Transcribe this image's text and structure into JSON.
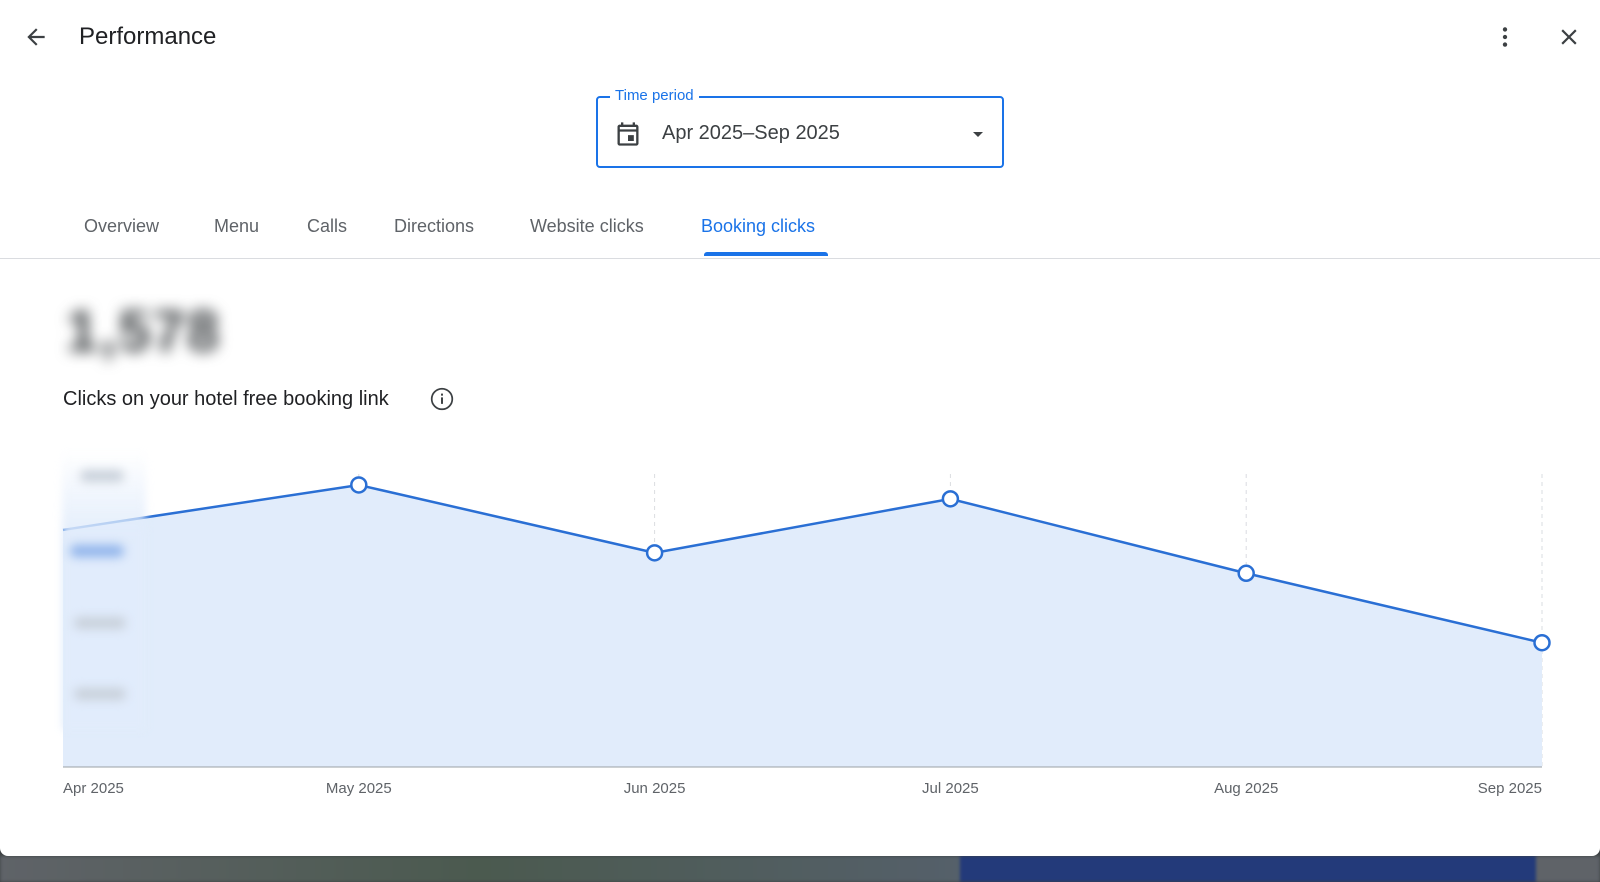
{
  "header": {
    "title": "Performance",
    "back_icon": "arrow-back-icon",
    "more_icon": "more-vert-icon",
    "close_icon": "close-icon"
  },
  "time_period": {
    "label": "Time period",
    "value": "Apr 2025–Sep 2025",
    "icon": "calendar-icon"
  },
  "tabs": [
    {
      "label": "Overview",
      "active": false
    },
    {
      "label": "Menu",
      "active": false
    },
    {
      "label": "Calls",
      "active": false
    },
    {
      "label": "Directions",
      "active": false
    },
    {
      "label": "Website clicks",
      "active": false
    },
    {
      "label": "Booking clicks",
      "active": true
    }
  ],
  "metric": {
    "value": "1,578",
    "label": "Clicks on your hotel free booking link"
  },
  "colors": {
    "accent": "#1a73e8",
    "line": "#2a6fd4",
    "area_fill": "#e1ecfb"
  },
  "chart_data": {
    "type": "area",
    "x": [
      "Apr 2025",
      "May 2025",
      "Jun 2025",
      "Jul 2025",
      "Aug 2025",
      "Sep 2025"
    ],
    "series": [
      {
        "values": [
          290,
          345,
          262,
          328,
          237,
          152
        ]
      }
    ],
    "ylim": [
      0,
      400
    ],
    "grid": "vertical dashed",
    "y_axis_labels_visible": false
  }
}
